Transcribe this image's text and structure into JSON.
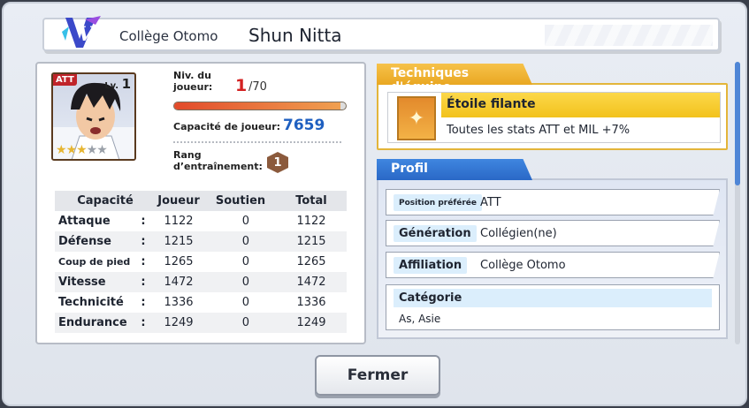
{
  "header": {
    "logo_text": "V",
    "school": "Collège Otomo",
    "player_name": "Shun Nitta"
  },
  "card": {
    "position_badge": "ATT",
    "level_prefix": "Lv.",
    "level": "1",
    "stars": {
      "filled": 3,
      "total": 5
    }
  },
  "player": {
    "level_label": "Niv. du joueur:",
    "level_current": "1",
    "level_max": "/70",
    "level_progress": 0.0,
    "capacity_label": "Capacité de joueur:",
    "capacity_value": "7659",
    "rank_label": "Rang d’entraînement:",
    "rank_value": "1"
  },
  "stats": {
    "headers": [
      "Capacité",
      "Joueur",
      "Soutien",
      "Total"
    ],
    "rows": [
      {
        "name": "Attaque",
        "player": "1122",
        "support": "0",
        "total": "1122"
      },
      {
        "name": "Défense",
        "player": "1215",
        "support": "0",
        "total": "1215"
      },
      {
        "name": "Coup de pied",
        "player": "1265",
        "support": "0",
        "total": "1265"
      },
      {
        "name": "Vitesse",
        "player": "1472",
        "support": "0",
        "total": "1472"
      },
      {
        "name": "Technicité",
        "player": "1336",
        "support": "0",
        "total": "1336"
      },
      {
        "name": "Endurance",
        "player": "1249",
        "support": "0",
        "total": "1249"
      }
    ]
  },
  "techniques": {
    "tab_label": "Techniques d'équipe",
    "name": "Étoile filante",
    "description": "Toutes les stats ATT et MIL +7%"
  },
  "profile": {
    "tab_label": "Profil",
    "preferred_position_label": "Position préférée",
    "preferred_position_value": "ATT",
    "generation_label": "Génération",
    "generation_value": "Collégien(ne)",
    "affiliation_label": "Affiliation",
    "affiliation_value": "Collège Otomo",
    "category_label": "Catégorie",
    "category_value": "As, Asie"
  },
  "buttons": {
    "close": "Fermer"
  },
  "colors": {
    "level_red": "#d32222",
    "capacity_blue": "#1e5fc0",
    "tech_gold": "#f2c21c",
    "profile_blue": "#2a68c6"
  }
}
